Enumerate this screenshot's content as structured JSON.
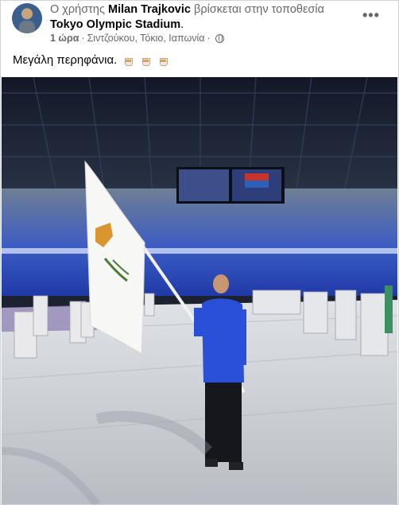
{
  "post": {
    "prefix": "Ο χρήστης",
    "author": "Milan Trajkovic",
    "location_text": "βρίσκεται στην τοποθεσία",
    "place": "Tokyo Olympic Stadium",
    "place_suffix": ".",
    "time": "1 ώρα",
    "separator": "·",
    "location_meta": "Σιντζούκου, Τόκιο, Ιαπωνία",
    "caption": "Μεγάλη περηφάνια.",
    "more_label": "•••",
    "privacy_icon": "globe-icon",
    "emoji_icon": "drink-cup-icon"
  },
  "photo": {
    "scene": "Cyprus flag bearer in Tokyo Olympic Stadium",
    "colors": {
      "flag_copper": "#d9962f",
      "flag_green": "#4f7d3a",
      "jersey": "#2a4fd8",
      "floor": "#c9ccd1",
      "stands": "#2c4fbd"
    }
  }
}
